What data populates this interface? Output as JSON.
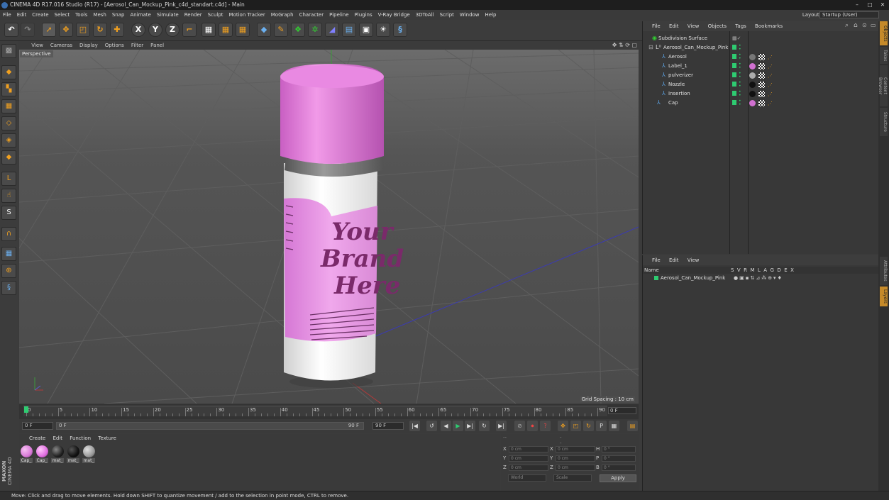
{
  "window": {
    "title": "CINEMA 4D R17.016 Studio (R17) - [Aerosol_Can_Mockup_Pink_c4d_standart.c4d] - Main"
  },
  "menu": [
    "File",
    "Edit",
    "Create",
    "Select",
    "Tools",
    "Mesh",
    "Snap",
    "Animate",
    "Simulate",
    "Render",
    "Sculpt",
    "Motion Tracker",
    "MoGraph",
    "Character",
    "Pipeline",
    "Plugins",
    "V-Ray Bridge",
    "3DToAll",
    "Script",
    "Window",
    "Help"
  ],
  "layout": {
    "label": "Layout:",
    "value": "Startup (User)"
  },
  "toolbar": {
    "x_label": "X",
    "y_label": "Y",
    "z_label": "Z"
  },
  "left_tools": {
    "s_label": "S"
  },
  "viewport": {
    "menu": [
      "View",
      "Cameras",
      "Display",
      "Options",
      "Filter",
      "Panel"
    ],
    "camera_label": "Perspective",
    "grid_spacing": "Grid Spacing : 10 cm",
    "can_label_lines": [
      "Your",
      "Brand",
      "Here"
    ]
  },
  "timeline": {
    "ticks": [
      "0",
      "5",
      "10",
      "15",
      "20",
      "25",
      "30",
      "35",
      "40",
      "45",
      "50",
      "55",
      "60",
      "65",
      "70",
      "75",
      "80",
      "85",
      "90"
    ],
    "current_frame": "0 F"
  },
  "playbar": {
    "start": "0 F",
    "range_start": "0 F",
    "range_end": "90 F",
    "end": "90 F"
  },
  "materials": {
    "menu": [
      "Create",
      "Edit",
      "Function",
      "Texture"
    ],
    "items": [
      {
        "label": "Cap_",
        "color": "#d87ad8"
      },
      {
        "label": "Cap_",
        "color": "#e06ee0"
      },
      {
        "label": "mat_",
        "color": "#222222"
      },
      {
        "label": "mat_",
        "color": "#1a1a1a"
      },
      {
        "label": "mat_",
        "color": "#9a9a9a"
      }
    ]
  },
  "brand": {
    "line1": "MAXON",
    "line2": "CINEMA 4D"
  },
  "coordinates": {
    "header": "--",
    "header2": "--",
    "rows": [
      {
        "a": "X",
        "av": "0 cm",
        "b": "X",
        "bv": "0 cm",
        "c": "H",
        "cv": "0 °"
      },
      {
        "a": "Y",
        "av": "0 cm",
        "b": "Y",
        "bv": "0 cm",
        "c": "P",
        "cv": "0 °"
      },
      {
        "a": "Z",
        "av": "0 cm",
        "b": "Z",
        "bv": "0 cm",
        "c": "B",
        "cv": "0 °"
      }
    ],
    "space": "World",
    "mode": "Scale",
    "apply": "Apply"
  },
  "status": "Move: Click and drag to move elements. Hold down SHIFT to quantize movement / add to the selection in point mode, CTRL to remove.",
  "object_manager": {
    "menu": [
      "File",
      "Edit",
      "View",
      "Objects",
      "Tags",
      "Bookmarks"
    ],
    "objects": [
      {
        "name": "Subdivision Surface",
        "ball": ""
      },
      {
        "name": "Aerosol_Can_Mockup_Pink",
        "ball": ""
      },
      {
        "name": "Aerosol",
        "ball": "#777777"
      },
      {
        "name": "Label_1",
        "ball": "#d070d0"
      },
      {
        "name": "pulverizer",
        "ball": "#aaaaaa"
      },
      {
        "name": "Nozzle",
        "ball": "#111111"
      },
      {
        "name": "Insertion",
        "ball": "#111111"
      },
      {
        "name": "Cap",
        "ball": "#d070d0"
      }
    ]
  },
  "layer_manager": {
    "menu": [
      "File",
      "Edit",
      "View"
    ],
    "col_name": "Name",
    "col_flags": "S  V  R  M  L  A  G  D  E  X",
    "row": "Aerosol_Can_Mockup_Pink"
  },
  "side_tabs": [
    "Objects",
    "Takes",
    "Content Browser",
    "Structure",
    "Attributes",
    "Layers"
  ]
}
